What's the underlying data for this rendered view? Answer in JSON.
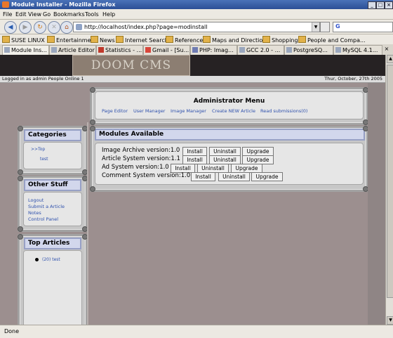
{
  "window": {
    "title": "Module Installer - Mozilla Firefox"
  },
  "menu": [
    "File",
    "Edit",
    "View",
    "Go",
    "Bookmarks",
    "Tools",
    "Help"
  ],
  "address": {
    "url": "http://localhost/index.php?page=modinstall"
  },
  "bookmarks": [
    "SUSE LINUX",
    "Entertainment",
    "News",
    "Internet Search",
    "Reference",
    "Maps and Directions",
    "Shopping",
    "People and Compa..."
  ],
  "tabs": [
    "Module Ins...",
    "Article Editor",
    "Statistics - ...",
    "Gmail - [Su...",
    "PHP: Imag...",
    "GCC 2.0 - ...",
    "PostgreSQ...",
    "MySQL 4.1..."
  ],
  "site": {
    "logo": "DOOM CMS",
    "logged_in": "Logged in as admin  People Online 1",
    "date": "Thur, October, 27th 2005"
  },
  "admin_menu": {
    "title": "Administrator Menu",
    "links": [
      "Page Editor",
      "User Manager",
      "Image Manager",
      "Create NEW Article",
      "Read submissions(0)"
    ]
  },
  "categories": {
    "title": "Categories",
    "items": [
      ">>Top",
      "test"
    ]
  },
  "other_stuff": {
    "title": "Other Stuff",
    "links": [
      "Logout",
      "Submit a Article",
      "Notes",
      "Control Panel"
    ]
  },
  "top_articles": {
    "title": "Top Articles",
    "items": [
      "(20) test"
    ]
  },
  "modules": {
    "title": "Modules Available",
    "rows": [
      {
        "name": "Image Archive version:1.0"
      },
      {
        "name": "Article System version:1.1"
      },
      {
        "name": "Ad System version:1.0"
      },
      {
        "name": "Comment System version:1.0"
      }
    ],
    "buttons": {
      "install": "Install",
      "uninstall": "Uninstall",
      "upgrade": "Upgrade"
    }
  },
  "status": "Done"
}
